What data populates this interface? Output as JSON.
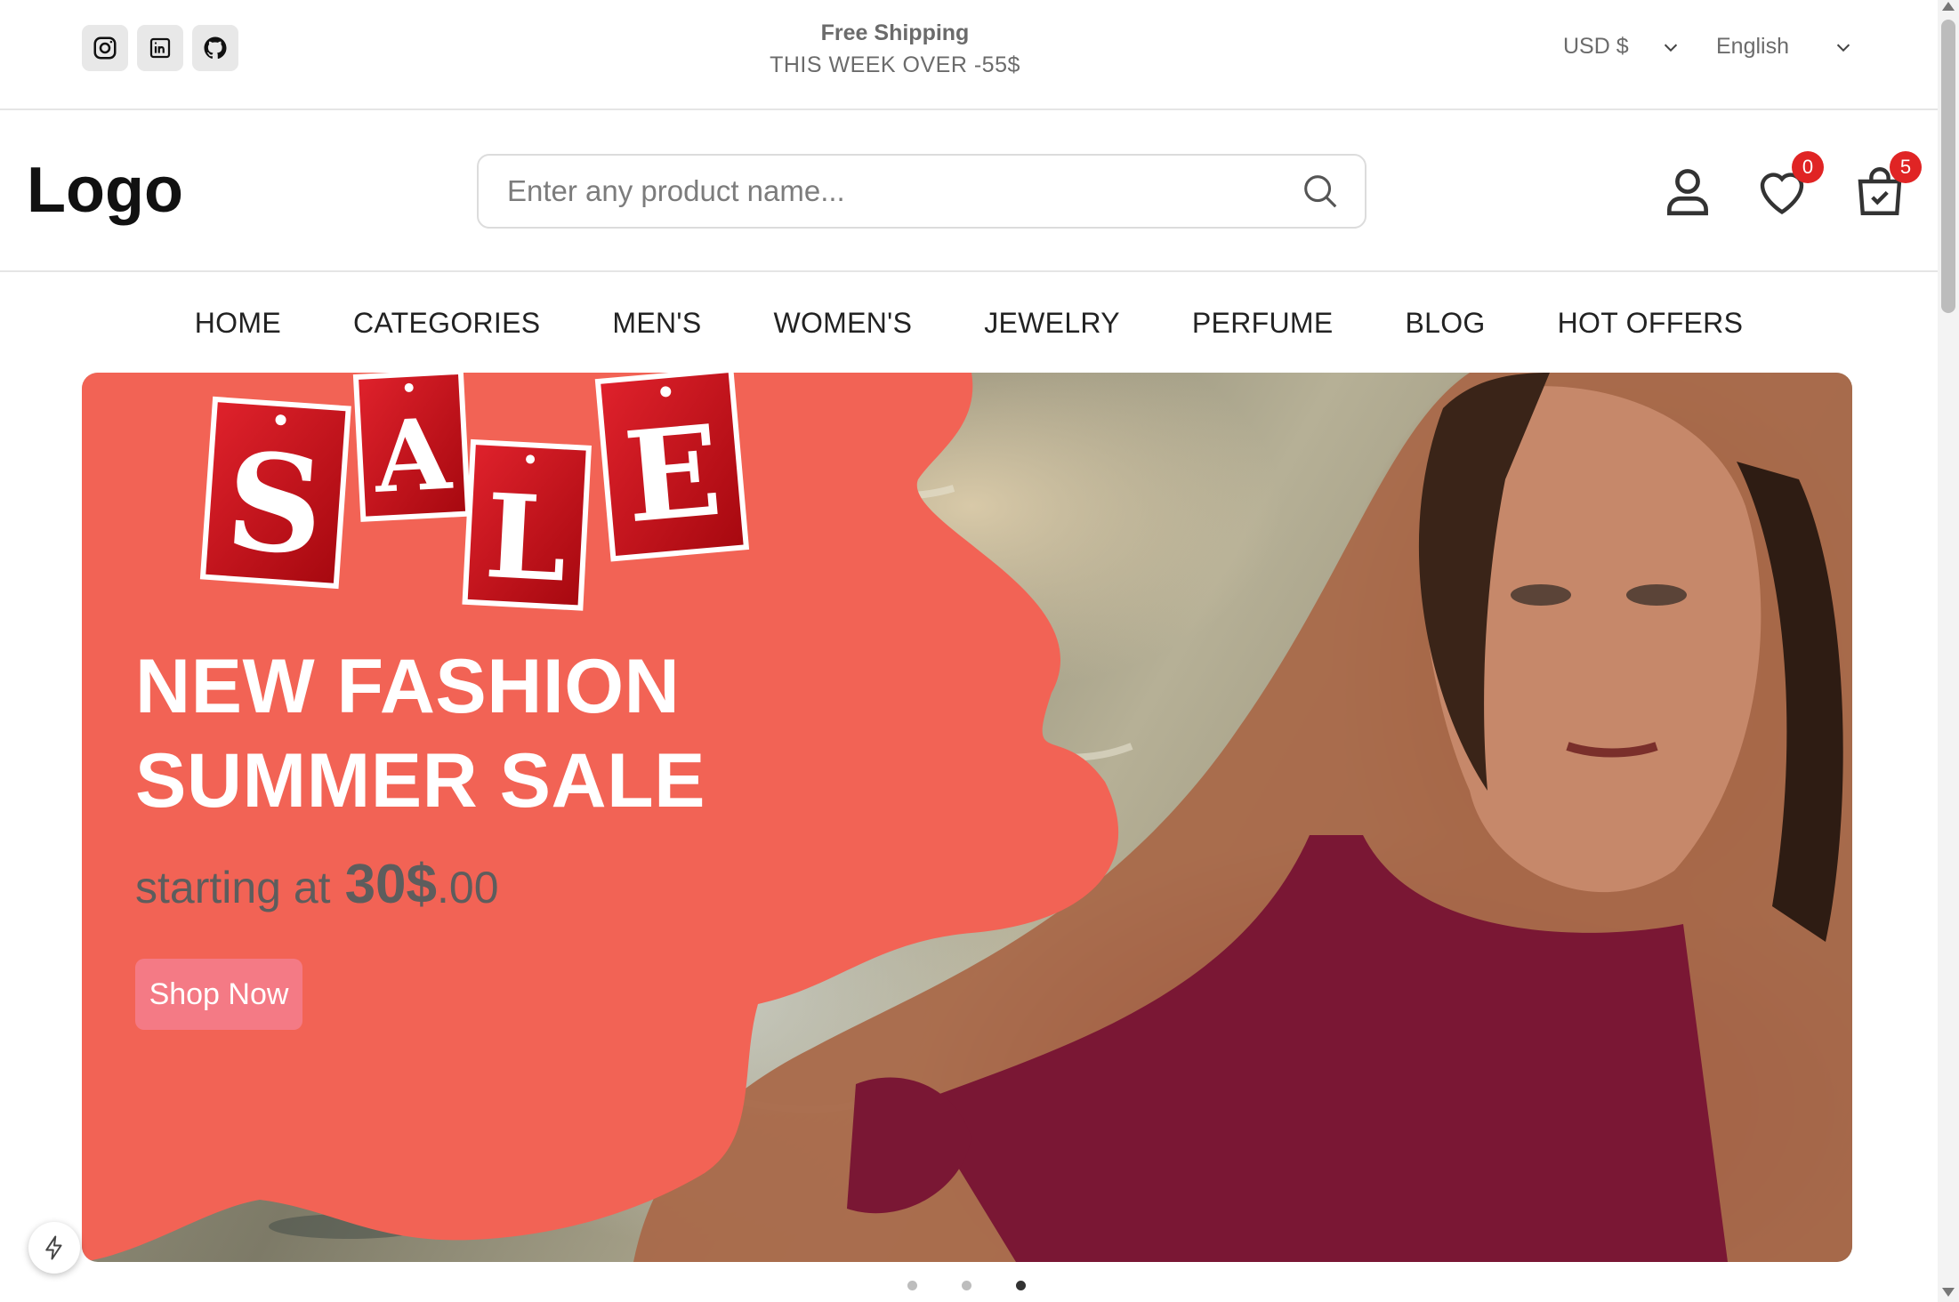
{
  "topbar": {
    "socials": [
      {
        "name": "instagram-icon"
      },
      {
        "name": "linkedin-icon"
      },
      {
        "name": "github-icon"
      }
    ],
    "promo_title": "Free Shipping",
    "promo_subtitle": "THIS WEEK OVER -55$",
    "currency": "USD $",
    "language": "English"
  },
  "header": {
    "logo": "Logo",
    "search_placeholder": "Enter any product name...",
    "wishlist_count": "0",
    "cart_count": "5"
  },
  "nav": {
    "items": [
      "HOME",
      "CATEGORIES",
      "MEN'S",
      "WOMEN'S",
      "JEWELRY",
      "PERFUME",
      "BLOG",
      "HOT OFFERS"
    ]
  },
  "hero": {
    "sale_letters": [
      "S",
      "A",
      "L",
      "E"
    ],
    "title_line1": "NEW FASHION",
    "title_line2": "SUMMER SALE",
    "price_prefix": "starting at",
    "price_amount": "30$",
    "price_cents": ".00",
    "cta": "Shop Now",
    "slides": 3,
    "active_slide": 3
  },
  "colors": {
    "accent": "#f47a85",
    "badge": "#e02424",
    "hero_blob": "#f26355",
    "sale_tag": "#c40f1b"
  }
}
